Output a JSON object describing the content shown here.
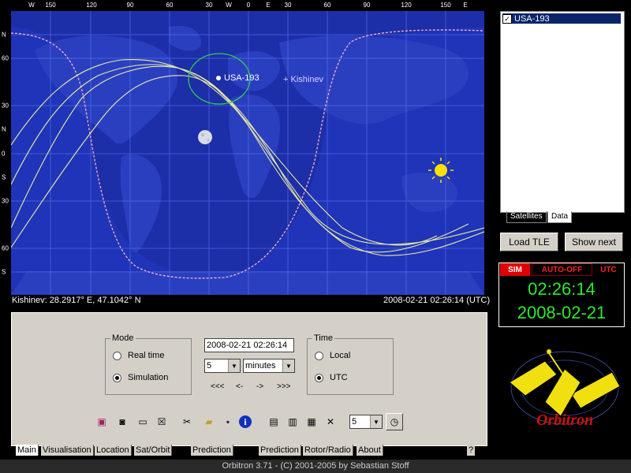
{
  "map": {
    "top_scale": [
      "W",
      "150",
      "120",
      "90",
      "60",
      "30",
      "W",
      "0",
      "E",
      "30",
      "60",
      "90",
      "120",
      "150",
      "E"
    ],
    "left_scale": [
      "N",
      "60",
      "30",
      "N",
      "0",
      "S",
      "30",
      "60",
      "S"
    ],
    "satellite_label": "USA-193",
    "station_label": "+ Kishinev",
    "status_left": "Kishinev: 28.2917° E, 47.1042° N",
    "status_right": "2008-02-21 02:26:14 (UTC)"
  },
  "satellites": {
    "items": [
      {
        "label": "USA-193",
        "checked": true
      }
    ],
    "tabs": [
      "Satellites",
      "Data"
    ]
  },
  "buttons": {
    "load_tle": "Load TLE",
    "show_next": "Show next"
  },
  "clock": {
    "sim": "SIM",
    "auto_off": "AUTO-OFF",
    "utc": "UTC",
    "time": "02:26:14",
    "date": "2008-02-21"
  },
  "mode": {
    "title": "Mode",
    "real_time": "Real time",
    "simulation": "Simulation",
    "selected": "simulation"
  },
  "sim_controls": {
    "datetime": "2008-02-21 02:26:14",
    "step_value": "5",
    "step_unit": "minutes",
    "nav": [
      "<<<",
      "<-",
      "->",
      ">>>"
    ]
  },
  "time_group": {
    "title": "Time",
    "local": "Local",
    "utc": "UTC",
    "selected": "utc"
  },
  "toolbar": {
    "icons": [
      "book-icon",
      "camera-icon",
      "minimize-icon",
      "close-window-icon",
      "tools-icon",
      "open-folder-icon",
      "save-disk-icon",
      "info-icon",
      "print-icon",
      "window-split-icon",
      "windows-icon",
      "fullscreen-icon"
    ],
    "speed_value": "5"
  },
  "bottom_tabs": [
    "Main",
    "Visualisation",
    "Location",
    "Sat/Orbit info",
    "Prediction setup",
    "Prediction",
    "Rotor/Radio",
    "About"
  ],
  "help_button": "?",
  "logo": {
    "text": "Orbitron"
  },
  "footer": "Orbitron 3.71 - (C) 2001-2005 by Sebastian Stoff"
}
